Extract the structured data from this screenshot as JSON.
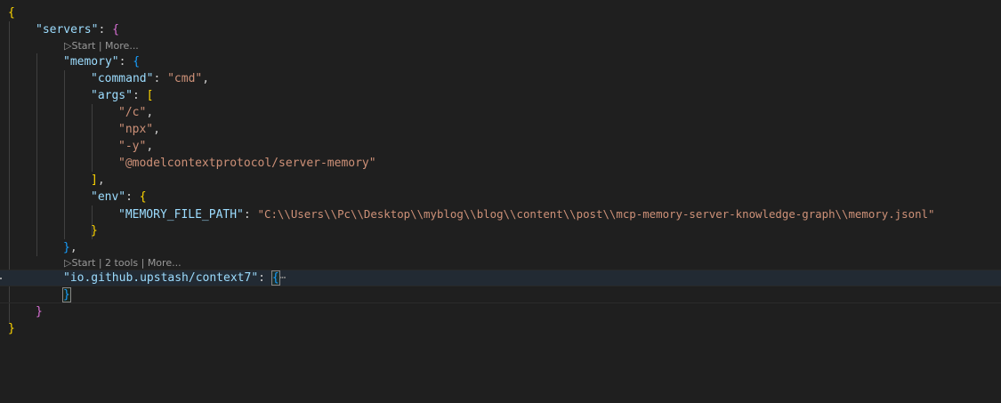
{
  "lens": {
    "servers_lens": {
      "start": "▷Start",
      "sep": " | ",
      "more": "More..."
    },
    "context7_lens": {
      "start": "▷Start",
      "sep1": " | ",
      "tools": "2 tools",
      "sep2": " | ",
      "more": "More..."
    }
  },
  "code": {
    "open_root": "{",
    "servers_key": "\"servers\"",
    "memory_key": "\"memory\"",
    "command_key": "\"command\"",
    "command_val": "\"cmd\"",
    "args_key": "\"args\"",
    "arg1": "\"/c\"",
    "arg2": "\"npx\"",
    "arg3": "\"-y\"",
    "arg4": "\"@modelcontextprotocol/server-memory\"",
    "env_key": "\"env\"",
    "memfile_key": "\"MEMORY_FILE_PATH\"",
    "memfile_val": "\"C:\\\\Users\\\\Pc\\\\Desktop\\\\myblog\\\\blog\\\\content\\\\post\\\\mcp-memory-server-knowledge-graph\\\\memory.jsonl\"",
    "context7_key": "\"io.github.upstash/context7\"",
    "fold_ellipsis": "⋯",
    "close_root": "}"
  },
  "colors": {
    "background": "#1f1f1f",
    "key": "#9cdcfe",
    "string": "#ce9178",
    "bracket_level1": "#ffd700",
    "bracket_level2": "#da70d6",
    "bracket_level3": "#179fff"
  }
}
